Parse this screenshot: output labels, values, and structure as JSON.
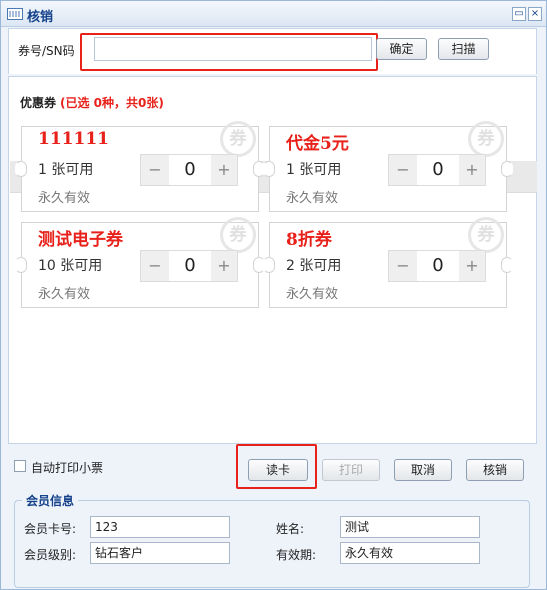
{
  "window": {
    "title": "核销",
    "minimize_glyph": "▭",
    "close_glyph": "×"
  },
  "top": {
    "sn_label": "券号/SN码",
    "sn_value": "",
    "confirm_label": "确定",
    "scan_label": "扫描"
  },
  "coupons": {
    "header_title": "优惠券",
    "header_summary": "(已选 0种，共0张)",
    "stamp_char": "券",
    "items": [
      {
        "name": "111111",
        "qty_text": "1 张可用",
        "validity": "永久有效",
        "count": "0"
      },
      {
        "name": "代金5元",
        "qty_text": "1 张可用",
        "validity": "永久有效",
        "count": "0"
      },
      {
        "name": "测试电子券",
        "qty_text": "10 张可用",
        "validity": "永久有效",
        "count": "0"
      },
      {
        "name": "8折券",
        "qty_text": "2 张可用",
        "validity": "永久有效",
        "count": "0"
      }
    ],
    "minus_glyph": "−",
    "plus_glyph": "+"
  },
  "actions": {
    "auto_print_label": "自动打印小票",
    "auto_print_checked": false,
    "read_card_label": "读卡",
    "print_label": "打印",
    "cancel_label": "取消",
    "verify_label": "核销"
  },
  "member": {
    "legend": "会员信息",
    "card_no_label": "会员卡号:",
    "card_no_value": "123",
    "name_label": "姓名:",
    "name_value": "测试",
    "level_label": "会员级别:",
    "level_value": "钻石客户",
    "expiry_label": "有效期:",
    "expiry_value": "永久有效"
  },
  "colors": {
    "accent_red": "#e8221b",
    "title_blue": "#15428b",
    "window_bg": "#eef3fa"
  },
  "icons": [
    "window-icon",
    "minimize-icon",
    "close-icon",
    "coupon-stamp-icon",
    "minus-icon",
    "plus-icon",
    "checkbox-icon"
  ]
}
